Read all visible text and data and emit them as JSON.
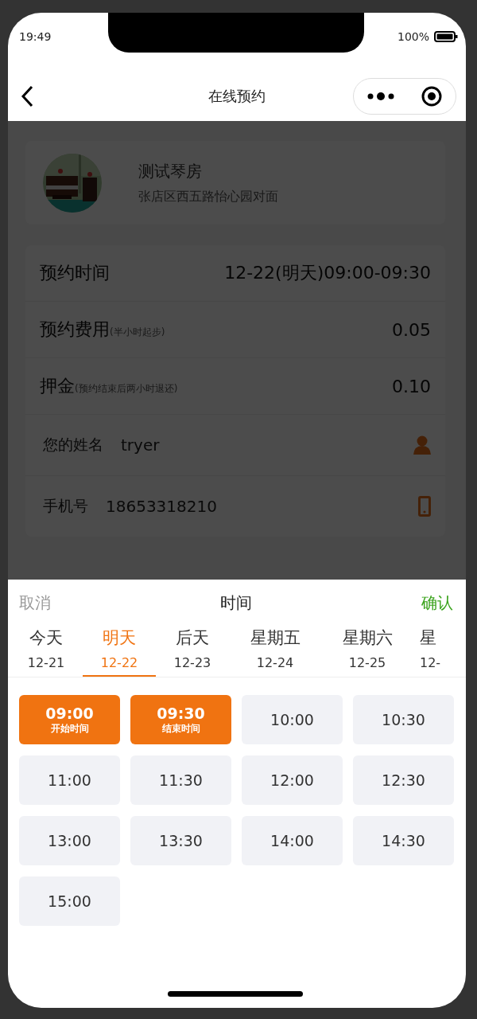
{
  "status_bar": {
    "time": "19:49",
    "battery": "100%"
  },
  "nav": {
    "title": "在线预约"
  },
  "venue": {
    "name": "测试琴房",
    "address": "张店区西五路怡心园对面"
  },
  "details": [
    {
      "kind": "info",
      "label": "预约时间",
      "value": "12-22(明天)09:00-09:30"
    },
    {
      "kind": "info",
      "label": "预约费用",
      "note": "(半小时起步)",
      "value": "0.05"
    },
    {
      "kind": "info",
      "label": "押金",
      "note": "(预约结束后两小时退还)",
      "value": "0.10"
    },
    {
      "kind": "name",
      "label": "您的姓名",
      "value": "tryer"
    },
    {
      "kind": "phone",
      "label": "手机号",
      "value": "18653318210"
    }
  ],
  "picker": {
    "cancel": "取消",
    "title": "时间",
    "confirm": "确认",
    "days": [
      {
        "label": "今天",
        "date": "12-21",
        "selected": false
      },
      {
        "label": "明天",
        "date": "12-22",
        "selected": true
      },
      {
        "label": "后天",
        "date": "12-23",
        "selected": false
      },
      {
        "label": "星期五",
        "date": "12-24",
        "selected": false
      },
      {
        "label": "星期六",
        "date": "12-25",
        "selected": false
      },
      {
        "label": "星",
        "date": "12-",
        "selected": false
      }
    ],
    "slots": [
      {
        "time": "09:00",
        "note": "开始时间",
        "selected": true
      },
      {
        "time": "09:30",
        "note": "结束时间",
        "selected": true
      },
      {
        "time": "10:00",
        "selected": false
      },
      {
        "time": "10:30",
        "selected": false
      },
      {
        "time": "11:00",
        "selected": false
      },
      {
        "time": "11:30",
        "selected": false
      },
      {
        "time": "12:00",
        "selected": false
      },
      {
        "time": "12:30",
        "selected": false
      },
      {
        "time": "13:00",
        "selected": false
      },
      {
        "time": "13:30",
        "selected": false
      },
      {
        "time": "14:00",
        "selected": false
      },
      {
        "time": "14:30",
        "selected": false
      },
      {
        "time": "15:00",
        "selected": false
      }
    ]
  }
}
